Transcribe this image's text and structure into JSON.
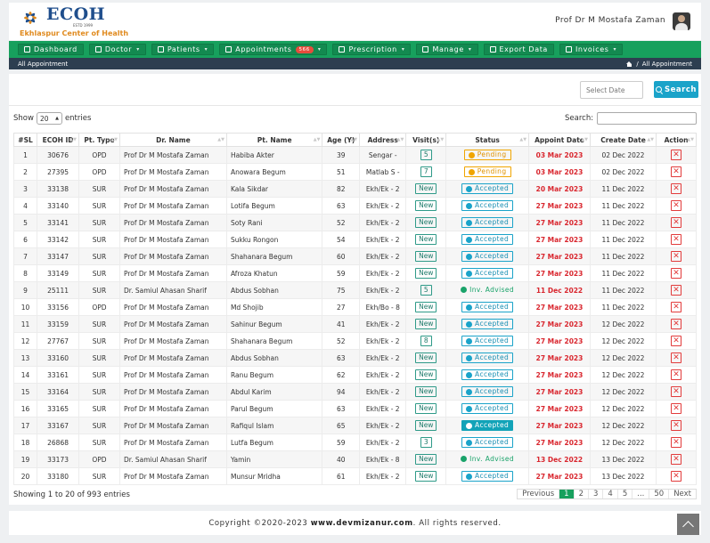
{
  "brand": {
    "logo_text": "ECOH",
    "estd": "ESTD 1999",
    "subtitle": "Ekhlaspur Center of Health"
  },
  "user": {
    "name": "Prof Dr M Mostafa Zaman"
  },
  "nav": [
    {
      "label": "Dashboard",
      "caret": false
    },
    {
      "label": "Doctor",
      "caret": true
    },
    {
      "label": "Patients",
      "caret": true
    },
    {
      "label": "Appointments",
      "badge": "566",
      "caret": true
    },
    {
      "label": "Prescription",
      "caret": true
    },
    {
      "label": "Manage",
      "caret": true
    },
    {
      "label": "Export Data",
      "caret": false
    },
    {
      "label": "Invoices",
      "caret": true
    }
  ],
  "breadcrumb": {
    "page": "All Appointment",
    "trail_home": "All Appointment"
  },
  "search": {
    "date_placeholder": "Select Date",
    "button": "Search"
  },
  "table_controls": {
    "show": "Show",
    "entries_value": "20",
    "entries": "entries",
    "filter_label": "Search:"
  },
  "columns": [
    "#SL",
    "ECOH ID",
    "Pt. Type",
    "Dr. Name",
    "Pt. Name",
    "Age (Y)",
    "Address",
    "Visit(s)",
    "Status",
    "Appoint Date",
    "Create Date",
    "Action"
  ],
  "rows": [
    [
      "1",
      "30676",
      "OPD",
      "Prof Dr M Mostafa Zaman",
      "Habiba Akter",
      "39",
      "Sengar -",
      "5",
      "Pending",
      "03 Mar 2023",
      "02 Dec 2022"
    ],
    [
      "2",
      "27395",
      "OPD",
      "Prof Dr M Mostafa Zaman",
      "Anowara Begum",
      "51",
      "Matlab S -",
      "7",
      "Pending",
      "03 Mar 2023",
      "02 Dec 2022"
    ],
    [
      "3",
      "33138",
      "SUR",
      "Prof Dr M Mostafa Zaman",
      "Kala Sikdar",
      "82",
      "Ekh/Ek - 2",
      "New",
      "Accepted",
      "20 Mar 2023",
      "11 Dec 2022"
    ],
    [
      "4",
      "33140",
      "SUR",
      "Prof Dr M Mostafa Zaman",
      "Lotifa Begum",
      "63",
      "Ekh/Ek - 2",
      "New",
      "Accepted",
      "27 Mar 2023",
      "11 Dec 2022"
    ],
    [
      "5",
      "33141",
      "SUR",
      "Prof Dr M Mostafa Zaman",
      "Soty Rani",
      "52",
      "Ekh/Ek - 2",
      "New",
      "Accepted",
      "27 Mar 2023",
      "11 Dec 2022"
    ],
    [
      "6",
      "33142",
      "SUR",
      "Prof Dr M Mostafa Zaman",
      "Sukku Rongon",
      "54",
      "Ekh/Ek - 2",
      "New",
      "Accepted",
      "27 Mar 2023",
      "11 Dec 2022"
    ],
    [
      "7",
      "33147",
      "SUR",
      "Prof Dr M Mostafa Zaman",
      "Shahanara Begum",
      "60",
      "Ekh/Ek - 2",
      "New",
      "Accepted",
      "27 Mar 2023",
      "11 Dec 2022"
    ],
    [
      "8",
      "33149",
      "SUR",
      "Prof Dr M Mostafa Zaman",
      "Afroza Khatun",
      "59",
      "Ekh/Ek - 2",
      "New",
      "Accepted",
      "27 Mar 2023",
      "11 Dec 2022"
    ],
    [
      "9",
      "25111",
      "SUR",
      "Dr. Samiul Ahasan Sharif",
      "Abdus Sobhan",
      "75",
      "Ekh/Ek - 2",
      "5",
      "Inv. Advised",
      "11 Dec 2022",
      "11 Dec 2022"
    ],
    [
      "10",
      "33156",
      "OPD",
      "Prof Dr M Mostafa Zaman",
      "Md Shojib",
      "27",
      "Ekh/Bo - 8",
      "New",
      "Accepted",
      "27 Mar 2023",
      "11 Dec 2022"
    ],
    [
      "11",
      "33159",
      "SUR",
      "Prof Dr M Mostafa Zaman",
      "Sahinur Begum",
      "41",
      "Ekh/Ek - 2",
      "New",
      "Accepted",
      "27 Mar 2023",
      "12 Dec 2022"
    ],
    [
      "12",
      "27767",
      "SUR",
      "Prof Dr M Mostafa Zaman",
      "Shahanara Begum",
      "52",
      "Ekh/Ek - 2",
      "8",
      "Accepted",
      "27 Mar 2023",
      "12 Dec 2022"
    ],
    [
      "13",
      "33160",
      "SUR",
      "Prof Dr M Mostafa Zaman",
      "Abdus Sobhan",
      "63",
      "Ekh/Ek - 2",
      "New",
      "Accepted",
      "27 Mar 2023",
      "12 Dec 2022"
    ],
    [
      "14",
      "33161",
      "SUR",
      "Prof Dr M Mostafa Zaman",
      "Ranu Begum",
      "62",
      "Ekh/Ek - 2",
      "New",
      "Accepted",
      "27 Mar 2023",
      "12 Dec 2022"
    ],
    [
      "15",
      "33164",
      "SUR",
      "Prof Dr M Mostafa Zaman",
      "Abdul Karim",
      "94",
      "Ekh/Ek - 2",
      "New",
      "Accepted",
      "27 Mar 2023",
      "12 Dec 2022"
    ],
    [
      "16",
      "33165",
      "SUR",
      "Prof Dr M Mostafa Zaman",
      "Parul Begum",
      "63",
      "Ekh/Ek - 2",
      "New",
      "Accepted",
      "27 Mar 2023",
      "12 Dec 2022"
    ],
    [
      "17",
      "33167",
      "SUR",
      "Prof Dr M Mostafa Zaman",
      "Rafiqul Islam",
      "65",
      "Ekh/Ek - 2",
      "New",
      "Accepted",
      "27 Mar 2023",
      "12 Dec 2022"
    ],
    [
      "18",
      "26868",
      "SUR",
      "Prof Dr M Mostafa Zaman",
      "Lutfa Begum",
      "59",
      "Ekh/Ek - 2",
      "3",
      "Accepted",
      "27 Mar 2023",
      "12 Dec 2022"
    ],
    [
      "19",
      "33173",
      "OPD",
      "Dr. Samiul Ahasan Sharif",
      "Yamin",
      "40",
      "Ekh/Ek - 8",
      "New",
      "Inv. Advised",
      "13 Dec 2022",
      "13 Dec 2022"
    ],
    [
      "20",
      "33180",
      "SUR",
      "Prof Dr M Mostafa Zaman",
      "Munsur Mridha",
      "61",
      "Ekh/Ek - 2",
      "New",
      "Accepted",
      "27 Mar 2023",
      "13 Dec 2022"
    ]
  ],
  "highlight_row": 17,
  "action_icon": "close-icon",
  "info": "Showing 1 to 20 of 993 entries",
  "pagination": [
    "Previous",
    "1",
    "2",
    "3",
    "4",
    "5",
    "...",
    "50",
    "Next"
  ],
  "pagination_active": "1",
  "footer": {
    "prefix": "Copyright ©2020-2023 ",
    "site": "www.devmizanur.com",
    "suffix": ". All rights reserved."
  },
  "colors": {
    "nav_green": "#17a05d",
    "breadcrumb": "#2d3e50",
    "pending": "#f0a500",
    "accepted": "#1aa3c9",
    "advised": "#1aa36a",
    "date_red": "#d9262e"
  }
}
